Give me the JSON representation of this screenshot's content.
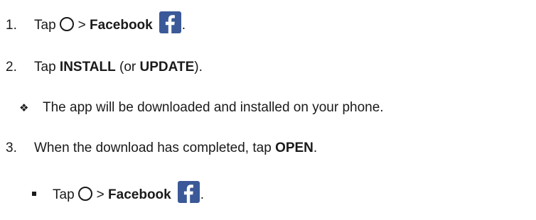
{
  "steps": [
    {
      "number": "1.",
      "text_before": "Tap",
      "separator": ">",
      "app_name": "Facebook",
      "end": "."
    },
    {
      "number": "2.",
      "text_before": "Tap",
      "strong_1": "INSTALL",
      "middle": "(or",
      "strong_2": "UPDATE",
      "end": ")."
    },
    {
      "number": "3.",
      "text_before": "When the download has completed, tap",
      "strong": "OPEN",
      "end": "."
    }
  ],
  "note": {
    "bullet": "❖",
    "text": "The app will be downloaded and installed on your phone."
  },
  "sub_step": {
    "text_before": "Tap",
    "separator": ">",
    "app_name": "Facebook",
    "end": "."
  },
  "icons": {
    "home": "home-circle-icon",
    "facebook": "facebook-icon",
    "facebook_color": "#3b5998"
  }
}
